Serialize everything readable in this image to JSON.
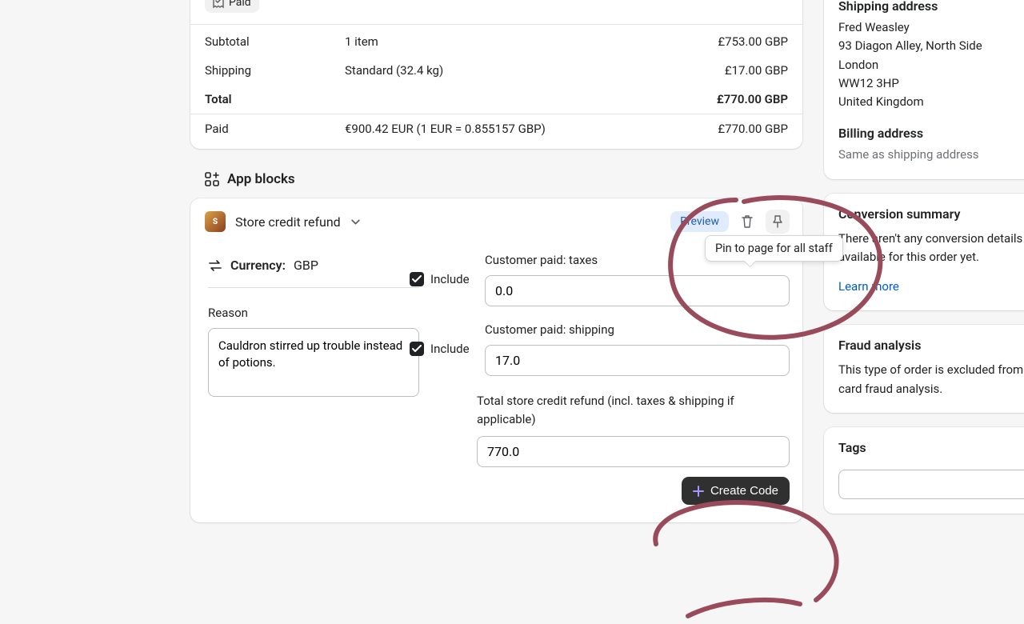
{
  "order": {
    "paid_label": "Paid",
    "totals": {
      "subtotal": {
        "label": "Subtotal",
        "detail": "1 item",
        "amount": "£753.00 GBP"
      },
      "shipping": {
        "label": "Shipping",
        "detail": "Standard (32.4 kg)",
        "amount": "£17.00 GBP"
      },
      "total": {
        "label": "Total",
        "detail": "",
        "amount": "£770.00 GBP"
      },
      "paid": {
        "label": "Paid",
        "detail": "€900.42 EUR (1 EUR = 0.855157 GBP)",
        "amount": "£770.00 GBP"
      }
    }
  },
  "app_blocks": {
    "title": "App blocks",
    "store_credit": {
      "name": "Store credit refund",
      "preview_label": "Preview",
      "currency_label": "Currency:",
      "currency": "GBP",
      "reason_label": "Reason",
      "reason_value": "Cauldron stirred up trouble instead of potions.",
      "include_label": "Include",
      "taxes": {
        "label": "Customer paid: taxes",
        "value": "0.0"
      },
      "shipping": {
        "label": "Customer paid: shipping",
        "value": "17.0"
      },
      "total": {
        "label": "Total store credit refund (incl. taxes & shipping if applicable)",
        "value": "770.0"
      },
      "create_label": "Create Code"
    }
  },
  "tooltip": {
    "pin_text": "Pin to page for all staff"
  },
  "sidebar": {
    "shipping": {
      "title": "Shipping address",
      "lines": [
        "Fred Weasley",
        "93 Diagon Alley, North Side",
        "London",
        "WW12 3HP",
        "United Kingdom"
      ]
    },
    "billing": {
      "title": "Billing address",
      "text": "Same as shipping address"
    },
    "conversion": {
      "title": "Conversion summary",
      "text": "There aren't any conversion details available for this order yet.",
      "learn_more": "Learn more"
    },
    "fraud": {
      "title": "Fraud analysis",
      "text": "This type of order is excluded from card fraud analysis."
    },
    "tags": {
      "title": "Tags"
    }
  }
}
